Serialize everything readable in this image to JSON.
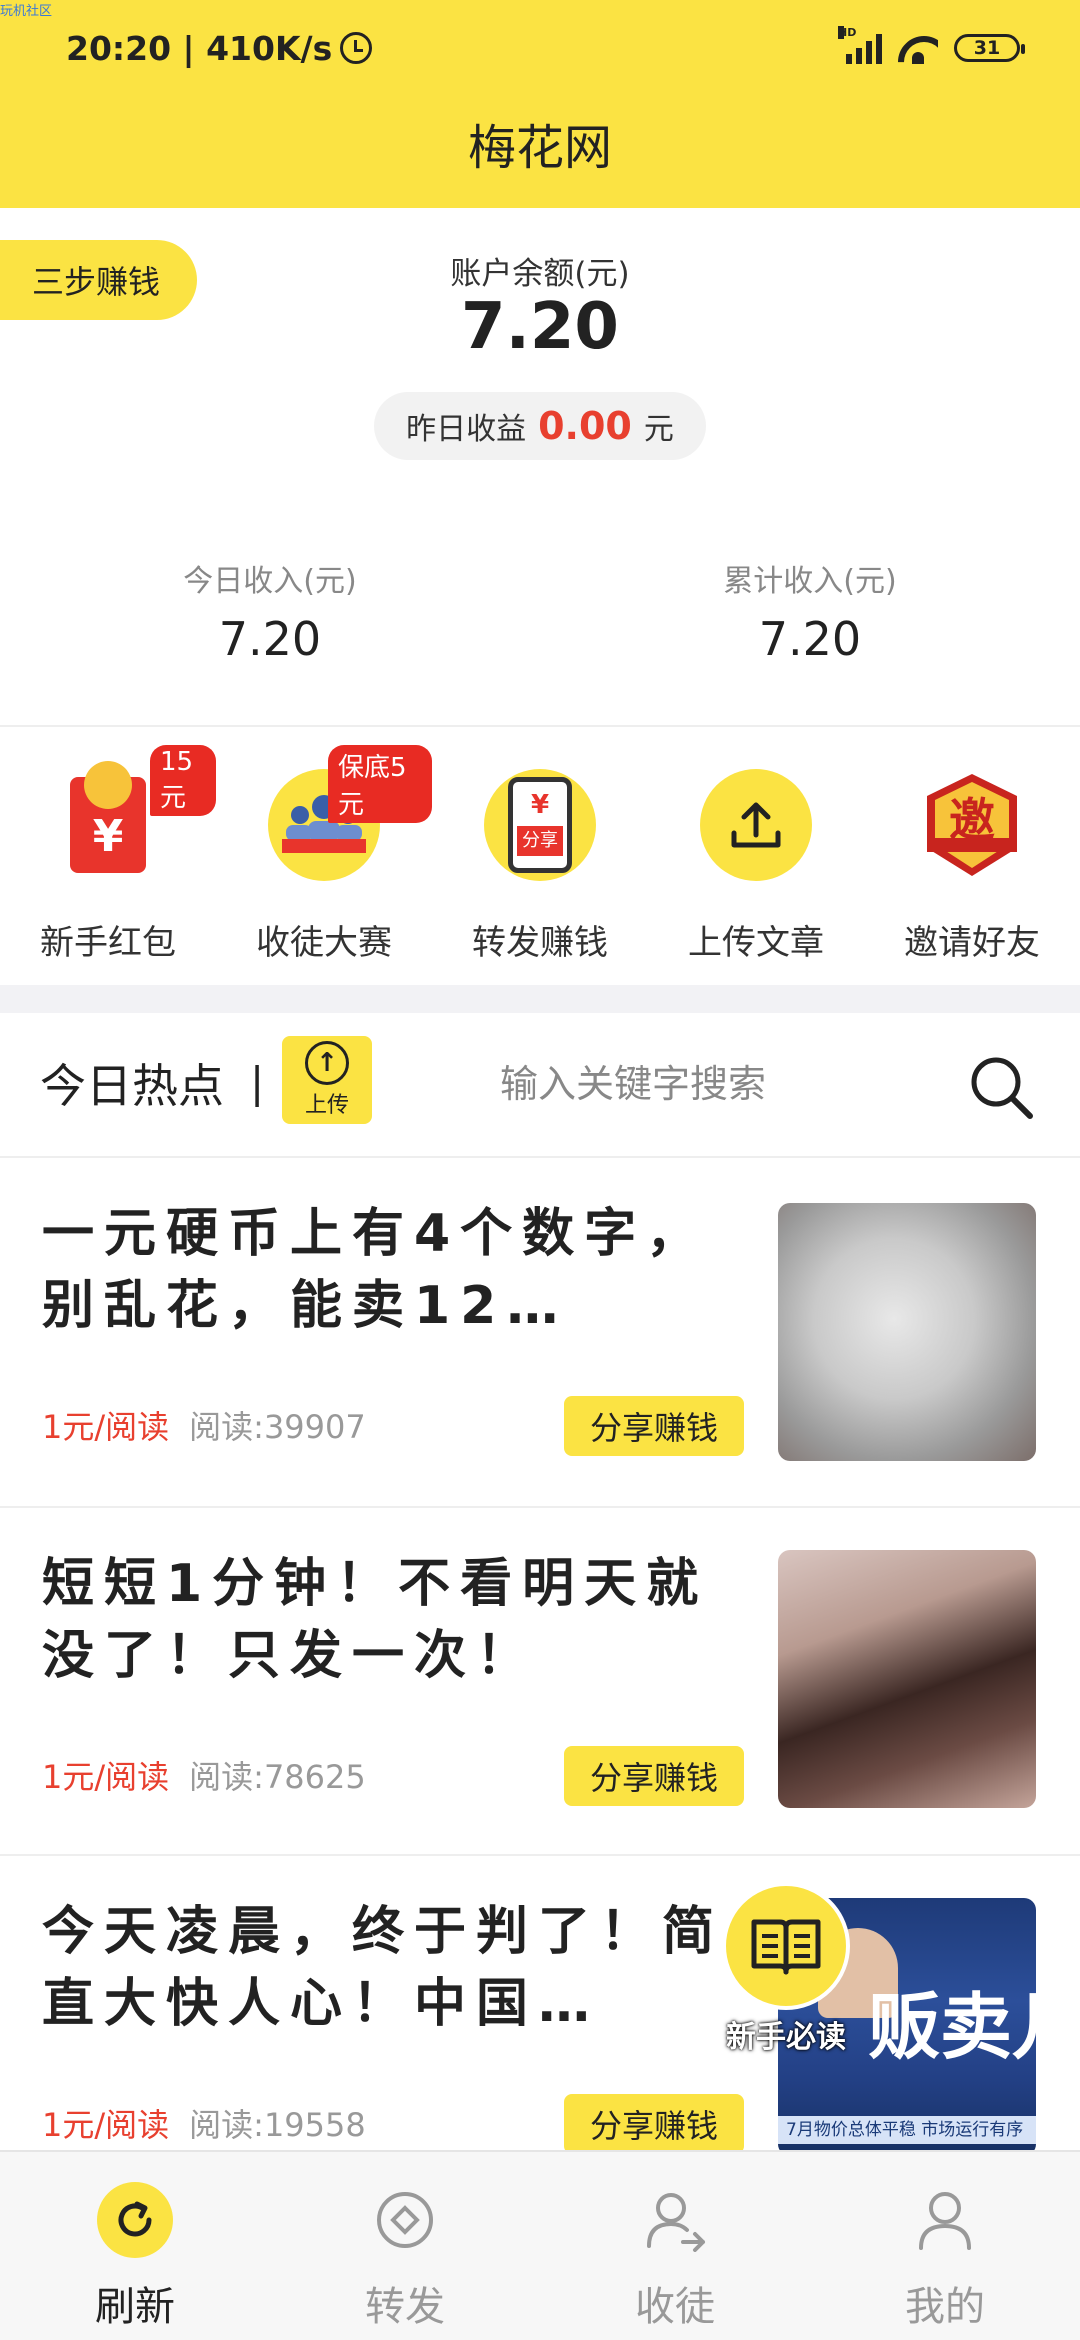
{
  "watermark": "玩机社区",
  "status_bar": {
    "time_speed": "20:20 | 410K/s",
    "network": "HD",
    "battery": "31"
  },
  "app_title": "梅花网",
  "steps_pill": "三步赚钱",
  "balance": {
    "label": "账户余额(元)",
    "value": "7.20"
  },
  "yesterday": {
    "label": "昨日收益",
    "value": "0.00",
    "unit": "元"
  },
  "stats": [
    {
      "label": "今日收入(元)",
      "value": "7.20"
    },
    {
      "label": "累计收入(元)",
      "value": "7.20"
    }
  ],
  "quick_actions": [
    {
      "label": "新手红包",
      "badge": "15元",
      "icon": "red-envelope-icon"
    },
    {
      "label": "收徒大赛",
      "badge": "保底5元",
      "icon": "contest-icon"
    },
    {
      "label": "转发赚钱",
      "badge": "",
      "icon": "share-phone-icon",
      "icon_text": "分享"
    },
    {
      "label": "上传文章",
      "badge": "",
      "icon": "upload-icon"
    },
    {
      "label": "邀请好友",
      "badge": "",
      "icon": "invite-badge-icon",
      "icon_text": "邀"
    }
  ],
  "hot": {
    "title": "今日热点",
    "separator": "|",
    "upload_label": "上传",
    "search_placeholder": "输入关键字搜索"
  },
  "articles": [
    {
      "title": "一元硬币上有4个数字，别乱花，能卖12…",
      "price": "1元/阅读",
      "reads": "阅读:39907",
      "share": "分享赚钱",
      "thumb": "coin-image"
    },
    {
      "title": "短短1分钟！不看明天就没了！只发一次！",
      "price": "1元/阅读",
      "reads": "阅读:78625",
      "share": "分享赚钱",
      "thumb": "blurred-image"
    },
    {
      "title": "今天凌晨，终于判了！简直大快人心！中国…",
      "price": "1元/阅读",
      "reads": "阅读:19558",
      "share": "分享赚钱",
      "thumb": "news-image",
      "thumb_text": "贩卖儿童",
      "thumb_ticker": "7月物价总体平稳 市场运行有序"
    }
  ],
  "newbie_float": {
    "label": "新手必读"
  },
  "bottom_nav": [
    {
      "label": "刷新",
      "icon": "refresh-icon",
      "active": true
    },
    {
      "label": "转发",
      "icon": "diamond-icon",
      "active": false
    },
    {
      "label": "收徒",
      "icon": "user-add-icon",
      "active": false
    },
    {
      "label": "我的",
      "icon": "user-icon",
      "active": false
    }
  ],
  "colors": {
    "accent": "#fbe343",
    "price_red": "#e8402f",
    "badge_red": "#e82b23"
  }
}
